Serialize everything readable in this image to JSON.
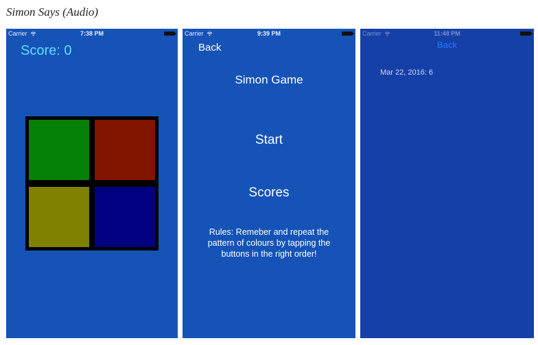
{
  "caption": "Simon Says (Audio)",
  "colors": {
    "screen_bg": "#1553b7",
    "screen3_bg": "#1540a8",
    "green": "#058105",
    "red": "#821400",
    "yellow": "#808100",
    "blue": "#000080",
    "score_text": "#5de0ff",
    "back_link_blue": "#1f7cff"
  },
  "screens": [
    {
      "status": {
        "carrier": "Carrier",
        "time": "7:38 PM"
      },
      "score_label": "Score: 0",
      "pads": [
        "green",
        "red",
        "yellow",
        "blue"
      ]
    },
    {
      "status": {
        "carrier": "Carrier",
        "time": "9:39 PM"
      },
      "back_label": "Back",
      "title": "Simon Game",
      "start_label": "Start",
      "scores_label": "Scores",
      "rules": "Rules: Remeber and repeat the pattern of colours by tapping the buttons in the right order!"
    },
    {
      "status": {
        "carrier": "Carrier",
        "time": "11:48 PM"
      },
      "back_label": "Back",
      "score_entries": [
        "Mar 22, 2016: 6"
      ]
    }
  ]
}
